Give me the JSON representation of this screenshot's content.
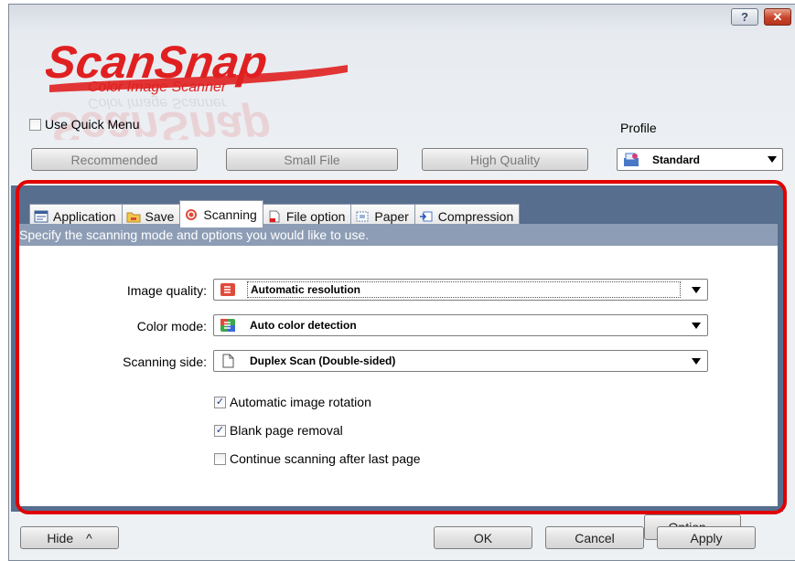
{
  "window": {
    "help_glyph": "?",
    "close_glyph": "✕"
  },
  "logo": {
    "brand": "ScanSnap",
    "tagline": "Color Image Scanner"
  },
  "quick_menu": {
    "label": "Use Quick Menu",
    "checked": false
  },
  "profile": {
    "label": "Profile",
    "selected": "Standard",
    "icon": "profile-icon"
  },
  "presets": [
    {
      "label": "Recommended"
    },
    {
      "label": "Small File"
    },
    {
      "label": "High Quality"
    }
  ],
  "tabs": [
    {
      "label": "Application",
      "icon": "application-icon",
      "active": false
    },
    {
      "label": "Save",
      "icon": "folder-icon",
      "active": false
    },
    {
      "label": "Scanning",
      "icon": "scanning-icon",
      "active": true
    },
    {
      "label": "File option",
      "icon": "file-option-icon",
      "active": false
    },
    {
      "label": "Paper",
      "icon": "paper-icon",
      "active": false
    },
    {
      "label": "Compression",
      "icon": "compression-icon",
      "active": false
    }
  ],
  "scanning": {
    "description": "Specify the scanning mode and options you would like to use.",
    "image_quality": {
      "label": "Image quality:",
      "value": "Automatic resolution",
      "icon": "resolution-icon"
    },
    "color_mode": {
      "label": "Color mode:",
      "value": "Auto color detection",
      "icon": "color-mode-icon"
    },
    "scanning_side": {
      "label": "Scanning side:",
      "value": "Duplex Scan (Double-sided)",
      "icon": "page-icon"
    },
    "options": [
      {
        "label": "Automatic image rotation",
        "checked": true
      },
      {
        "label": "Blank page removal",
        "checked": true
      },
      {
        "label": "Continue scanning after last page",
        "checked": false
      }
    ],
    "option_button": "Option..."
  },
  "footer": {
    "hide": "Hide",
    "hide_glyph": "^",
    "ok": "OK",
    "cancel": "Cancel",
    "apply": "Apply"
  },
  "colors": {
    "panel_bg": "#576e8e",
    "desc_bar": "#8d9db5",
    "highlight": "#e10000",
    "logo_red": "#e02020"
  }
}
